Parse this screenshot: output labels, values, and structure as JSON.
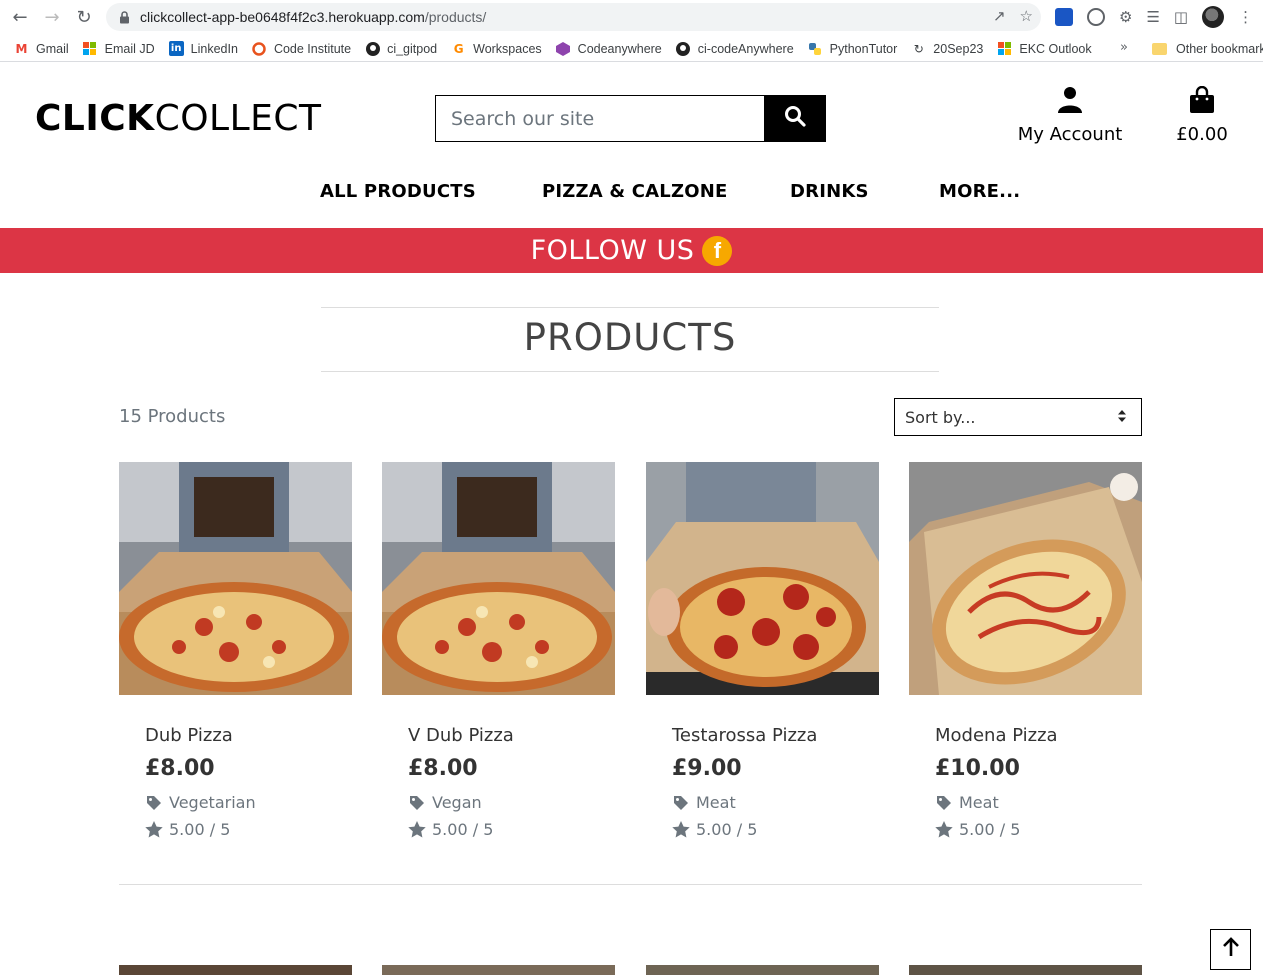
{
  "browser": {
    "url_domain": "clickcollect-app-be0648f4f2c3.herokuapp.com",
    "url_path": "/products/",
    "bookmarks": [
      {
        "label": "Gmail",
        "icon": "gmail-icon"
      },
      {
        "label": "Email JD",
        "icon": "windows-icon"
      },
      {
        "label": "LinkedIn",
        "icon": "linkedin-icon"
      },
      {
        "label": "Code Institute",
        "icon": "code-institute-icon"
      },
      {
        "label": "ci_gitpod",
        "icon": "github-icon"
      },
      {
        "label": "Workspaces",
        "icon": "gitpod-icon"
      },
      {
        "label": "Codeanywhere",
        "icon": "cube-icon"
      },
      {
        "label": "ci-codeAnywhere",
        "icon": "github-icon"
      },
      {
        "label": "PythonTutor",
        "icon": "python-icon"
      },
      {
        "label": "20Sep23",
        "icon": "sync-icon"
      },
      {
        "label": "EKC Outlook",
        "icon": "windows-icon"
      }
    ],
    "more": "»",
    "other_bookmarks": "Other bookmarks"
  },
  "header": {
    "logo_bold": "CLICK",
    "logo_regular": "COLLECT",
    "search_placeholder": "Search our site",
    "account_label": "My Account",
    "cart_total": "£0.00"
  },
  "nav": {
    "items": [
      "ALL PRODUCTS",
      "PIZZA & CALZONE",
      "DRINKS",
      "MORE..."
    ]
  },
  "banner": {
    "text": "FOLLOW US",
    "icon": "facebook-icon"
  },
  "page": {
    "title": "PRODUCTS",
    "count": "15 Products",
    "sort_selected": "Sort by..."
  },
  "products": [
    {
      "name": "Dub Pizza",
      "price": "£8.00",
      "category": "Vegetarian",
      "rating": "5.00 / 5"
    },
    {
      "name": "V Dub Pizza",
      "price": "£8.00",
      "category": "Vegan",
      "rating": "5.00 / 5"
    },
    {
      "name": "Testarossa Pizza",
      "price": "£9.00",
      "category": "Meat",
      "rating": "5.00 / 5"
    },
    {
      "name": "Modena Pizza",
      "price": "£10.00",
      "category": "Meat",
      "rating": "5.00 / 5"
    }
  ],
  "colors": {
    "banner": "#dc3545",
    "facebook_badge": "#f7a800",
    "text_muted": "#6c757d"
  }
}
